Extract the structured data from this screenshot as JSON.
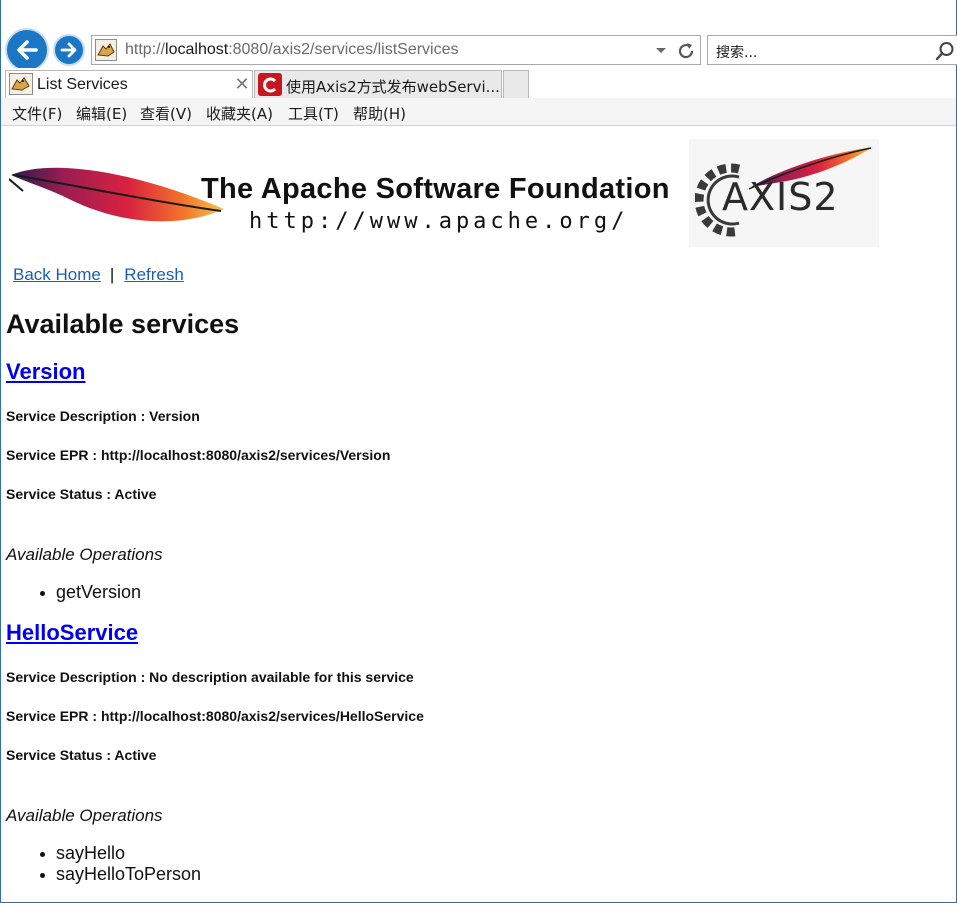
{
  "browser": {
    "address": {
      "url_prefix": "http://",
      "url_host": "localhost",
      "url_rest": ":8080/axis2/services/listServices"
    },
    "search": {
      "placeholder": "搜索..."
    },
    "tabs": [
      {
        "label": "List Services",
        "active": true
      },
      {
        "label": "使用Axis2方式发布webServi...",
        "active": false
      }
    ],
    "menu": [
      {
        "label": "文件(F)"
      },
      {
        "label": "编辑(E)"
      },
      {
        "label": "查看(V)"
      },
      {
        "label": "收藏夹(A)"
      },
      {
        "label": "工具(T)"
      },
      {
        "label": "帮助(H)"
      }
    ]
  },
  "banner": {
    "asf_title": "The Apache Software Foundation",
    "asf_url": "http://www.apache.org/",
    "axis_logo_text": "AXIS2"
  },
  "links": {
    "back_home": "Back Home",
    "separator": "|",
    "refresh": "Refresh"
  },
  "page_title": "Available services",
  "services": [
    {
      "name": "Version",
      "description": "Service Description : Version",
      "epr": "Service EPR : http://localhost:8080/axis2/services/Version",
      "status": "Service Status : Active",
      "operations_title": "Available Operations",
      "operations": [
        "getVersion"
      ]
    },
    {
      "name": "HelloService",
      "description": "Service Description : No description available for this service",
      "epr": "Service EPR : http://localhost:8080/axis2/services/HelloService",
      "status": "Service Status : Active",
      "operations_title": "Available Operations",
      "operations": [
        "sayHello",
        "sayHelloToPerson"
      ]
    }
  ],
  "colors": {
    "nav_blue": "#1b76c5",
    "link_blue": "#1a5fb4",
    "service_link": "#0000ee",
    "apache_red": "#b21f45"
  }
}
